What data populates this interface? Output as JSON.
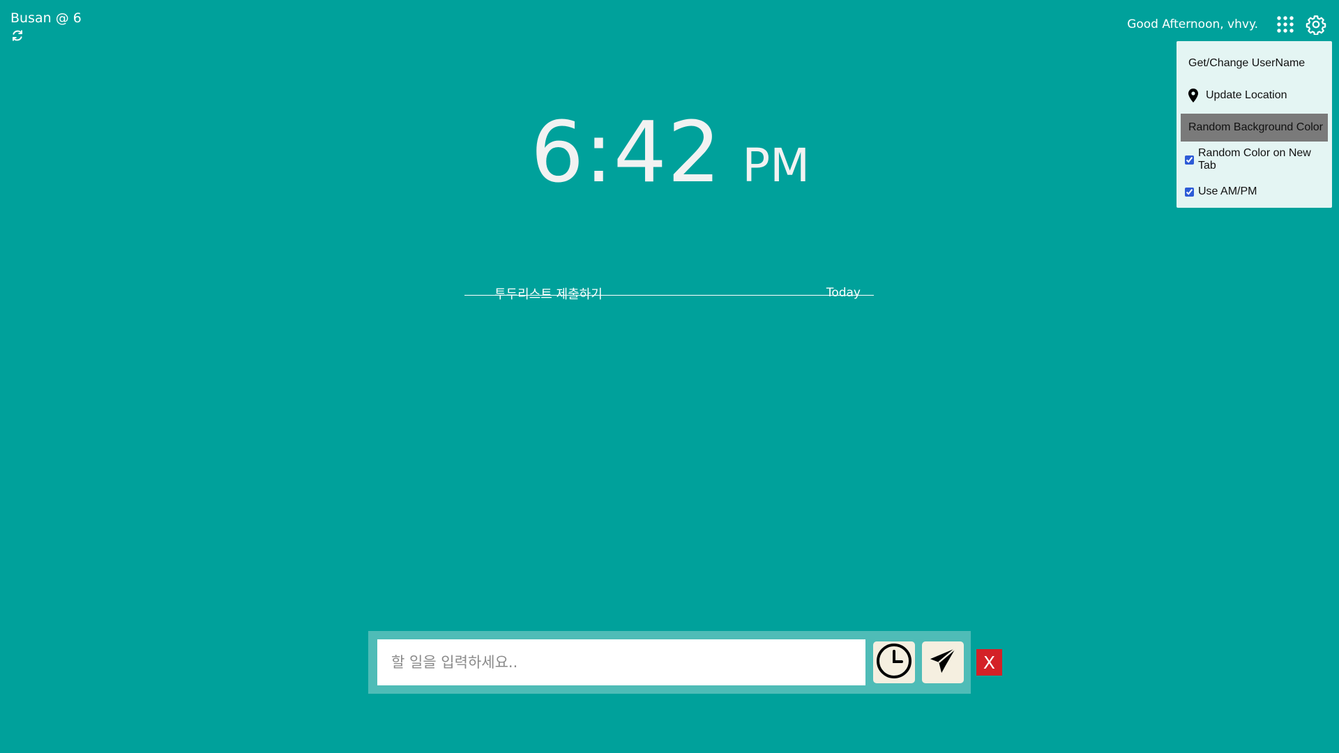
{
  "weather": {
    "label": "Busan @ 6",
    "refresh_icon": "refresh-icon"
  },
  "header": {
    "greeting": "Good Afternoon, vhvy.",
    "apps_icon": "grid-icon",
    "settings_icon": "gear-icon"
  },
  "settings_menu": {
    "items": [
      {
        "label": "Get/Change UserName"
      },
      {
        "label": "Update Location",
        "icon": "map-pin-icon"
      },
      {
        "label": "Random Background Color",
        "active": true
      },
      {
        "label": "Random Color on New Tab",
        "checked": true
      },
      {
        "label": "Use AM/PM",
        "checked": true
      }
    ]
  },
  "clock": {
    "time": "6:42",
    "ampm": "PM"
  },
  "todos": [
    {
      "text": "투두리스트 제출하기",
      "date": "Today",
      "completed": true
    }
  ],
  "input": {
    "placeholder": "할 일을 입력하세요..",
    "value": "",
    "clock_icon": "clock-icon",
    "send_icon": "send-icon",
    "close_label": "X"
  },
  "colors": {
    "background": "#00a19b",
    "input_bar": "#4fbcb7",
    "menu_background": "#e4f5f3",
    "active_menu_item": "#7a7a7a",
    "close_button": "#d42127"
  }
}
